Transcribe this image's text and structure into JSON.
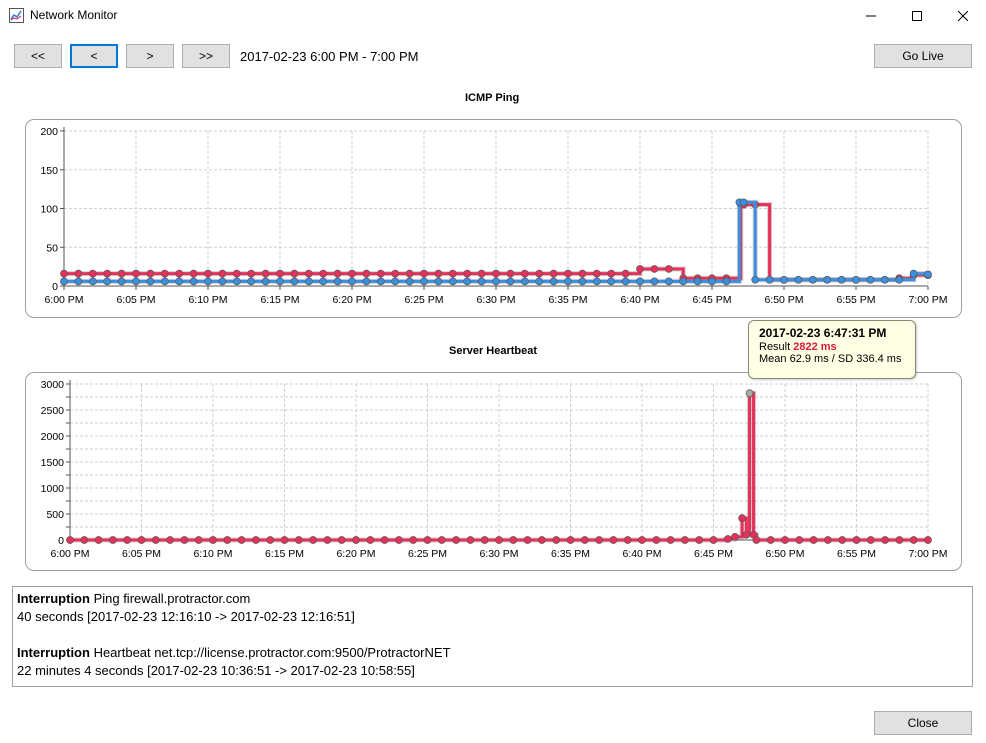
{
  "window": {
    "title": "Network Monitor"
  },
  "nav": {
    "first": "<<",
    "prev": "<",
    "next": ">",
    "last": ">>",
    "range": "2017-02-23 6:00 PM - 7:00 PM",
    "go_live": "Go Live",
    "close": "Close"
  },
  "charts": {
    "ping_title": "ICMP Ping",
    "heartbeat_title": "Server Heartbeat"
  },
  "tooltip": {
    "title": "2017-02-23 6:47:31 PM",
    "result_label": "Result",
    "result_value": "2822 ms",
    "stats": "Mean 62.9 ms / SD 336.4 ms"
  },
  "log": [
    {
      "kind": "Interruption",
      "target": "Ping firewall.protractor.com",
      "detail": "40 seconds [2017-02-23 12:16:10 -> 2017-02-23 12:16:51]"
    },
    {
      "kind": "Interruption",
      "target": "Heartbeat net.tcp://license.protractor.com:9500/ProtractorNET",
      "detail": "22 minutes 4 seconds [2017-02-23 10:36:51 -> 2017-02-23 10:58:55]"
    }
  ],
  "colors": {
    "red": "#e8315a",
    "blue": "#3c8fe0",
    "accent": "#0078d7"
  },
  "chart_data": [
    {
      "type": "line",
      "title": "ICMP Ping",
      "x_ticks": [
        "6:00 PM",
        "6:05 PM",
        "6:10 PM",
        "6:15 PM",
        "6:20 PM",
        "6:25 PM",
        "6:30 PM",
        "6:35 PM",
        "6:40 PM",
        "6:45 PM",
        "6:50 PM",
        "6:55 PM",
        "7:00 PM"
      ],
      "y_ticks": [
        "0",
        "50",
        "100",
        "150",
        "200"
      ],
      "ylim": [
        0,
        200
      ],
      "xlim_minutes": [
        0,
        60
      ],
      "series": [
        {
          "color": "red",
          "x": [
            0,
            1,
            2,
            3,
            4,
            5,
            6,
            7,
            8,
            9,
            10,
            11,
            12,
            13,
            14,
            15,
            16,
            17,
            18,
            19,
            20,
            21,
            22,
            23,
            24,
            25,
            26,
            27,
            28,
            29,
            30,
            31,
            32,
            33,
            34,
            35,
            36,
            37,
            38,
            39,
            40,
            41,
            42,
            43,
            44,
            45,
            46,
            47,
            47.2,
            48,
            49,
            50,
            51,
            52,
            53,
            54,
            55,
            56,
            57,
            58,
            59,
            60
          ],
          "y": [
            16,
            16,
            16,
            16,
            16,
            16,
            16,
            16,
            16,
            16,
            16,
            16,
            16,
            16,
            16,
            16,
            16,
            16,
            16,
            16,
            16,
            16,
            16,
            16,
            16,
            16,
            16,
            16,
            16,
            16,
            16,
            16,
            16,
            16,
            16,
            16,
            16,
            16,
            16,
            16,
            22,
            22,
            22,
            10,
            10,
            10,
            10,
            105,
            105,
            105,
            8,
            8,
            8,
            8,
            8,
            8,
            8,
            8,
            8,
            10,
            14,
            14
          ]
        },
        {
          "color": "blue",
          "x": [
            0,
            1,
            2,
            3,
            4,
            5,
            6,
            7,
            8,
            9,
            10,
            11,
            12,
            13,
            14,
            15,
            16,
            17,
            18,
            19,
            20,
            21,
            22,
            23,
            24,
            25,
            26,
            27,
            28,
            29,
            30,
            31,
            32,
            33,
            34,
            35,
            36,
            37,
            38,
            39,
            40,
            41,
            42,
            43,
            44,
            45,
            46,
            46.9,
            47.2,
            48,
            49,
            50,
            51,
            52,
            53,
            54,
            55,
            56,
            57,
            58,
            59,
            60
          ],
          "y": [
            6,
            6,
            6,
            6,
            6,
            6,
            6,
            6,
            6,
            6,
            6,
            6,
            6,
            6,
            6,
            6,
            6,
            6,
            6,
            6,
            6,
            6,
            6,
            6,
            6,
            6,
            6,
            6,
            6,
            6,
            6,
            6,
            6,
            6,
            6,
            6,
            6,
            6,
            6,
            6,
            6,
            6,
            6,
            6,
            6,
            6,
            6,
            108,
            108,
            8,
            8,
            8,
            8,
            8,
            8,
            8,
            8,
            8,
            8,
            8,
            16,
            15
          ]
        }
      ]
    },
    {
      "type": "line",
      "title": "Server Heartbeat",
      "x_ticks": [
        "6:00 PM",
        "6:05 PM",
        "6:10 PM",
        "6:15 PM",
        "6:20 PM",
        "6:25 PM",
        "6:30 PM",
        "6:35 PM",
        "6:40 PM",
        "6:45 PM",
        "6:50 PM",
        "6:55 PM",
        "7:00 PM"
      ],
      "y_ticks": [
        "0",
        "250",
        "500",
        "750",
        "1000",
        "1250",
        "1500",
        "1750",
        "2000",
        "2250",
        "2500",
        "2750",
        "3000"
      ],
      "y_tick_labels_shown": [
        "0",
        "500",
        "1000",
        "1500",
        "2000",
        "2500",
        "3000"
      ],
      "ylim": [
        0,
        3000
      ],
      "xlim_minutes": [
        0,
        60
      ],
      "series": [
        {
          "color": "red",
          "x": [
            0,
            1,
            2,
            3,
            4,
            5,
            6,
            7,
            8,
            9,
            10,
            11,
            12,
            13,
            14,
            15,
            16,
            17,
            18,
            19,
            20,
            21,
            22,
            23,
            24,
            25,
            26,
            27,
            28,
            29,
            30,
            31,
            32,
            33,
            34,
            35,
            36,
            37,
            38,
            39,
            40,
            41,
            42,
            43,
            44,
            45,
            46,
            46.5,
            47,
            47.3,
            47.52,
            47.8,
            48,
            49,
            50,
            51,
            52,
            53,
            54,
            55,
            56,
            57,
            58,
            59,
            60
          ],
          "y": [
            0,
            0,
            0,
            0,
            0,
            0,
            0,
            0,
            0,
            0,
            0,
            0,
            0,
            0,
            0,
            0,
            0,
            0,
            0,
            0,
            0,
            0,
            0,
            0,
            0,
            0,
            0,
            0,
            0,
            0,
            0,
            0,
            0,
            0,
            0,
            0,
            0,
            0,
            0,
            0,
            0,
            0,
            0,
            0,
            0,
            0,
            20,
            60,
            420,
            100,
            2822,
            100,
            0,
            0,
            0,
            0,
            0,
            0,
            0,
            0,
            0,
            0,
            0,
            0,
            0
          ]
        }
      ]
    }
  ]
}
